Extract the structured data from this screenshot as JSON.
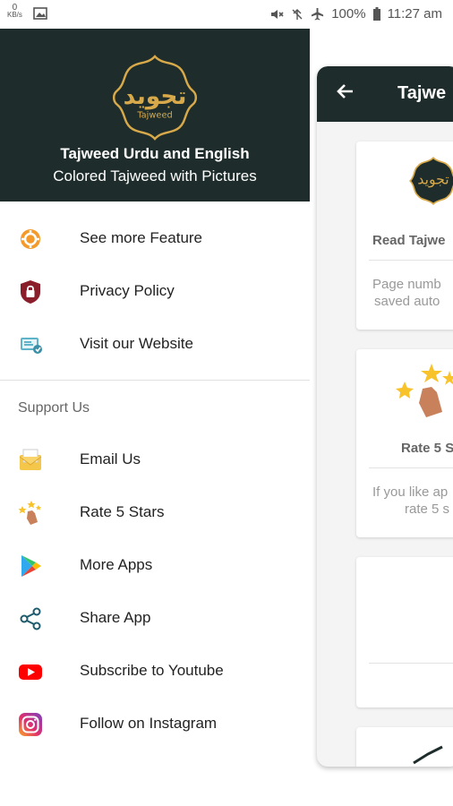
{
  "status_bar": {
    "net_speed_value": "0",
    "net_speed_unit": "KB/s",
    "battery": "100%",
    "time": "11:27 am"
  },
  "drawer": {
    "header": {
      "logo_arabic": "تجويد",
      "logo_latin": "Tajweed",
      "title": "Tajweed Urdu and English",
      "subtitle": "Colored Tajweed with Pictures"
    },
    "items": [
      {
        "label": "See more Feature",
        "icon": "gear-icon"
      },
      {
        "label": "Privacy Policy",
        "icon": "lock-icon"
      },
      {
        "label": "Visit our Website",
        "icon": "website-icon"
      }
    ],
    "support_section": {
      "label": "Support Us",
      "items": [
        {
          "label": "Email Us",
          "icon": "email-icon"
        },
        {
          "label": "Rate 5 Stars",
          "icon": "rate-stars-icon"
        },
        {
          "label": "More Apps",
          "icon": "play-store-icon"
        },
        {
          "label": "Share App",
          "icon": "share-icon"
        },
        {
          "label": "Subscribe to Youtube",
          "icon": "youtube-icon"
        },
        {
          "label": "Follow on Instagram",
          "icon": "instagram-icon"
        }
      ]
    }
  },
  "background_screen": {
    "toolbar_title": "Tajwe",
    "cards": [
      {
        "title": "Read Tajwe",
        "desc_line1": "Page numb",
        "desc_line2": "saved auto"
      },
      {
        "title": "Rate 5 S",
        "desc_line1": "If you like ap",
        "desc_line2": "rate 5 s"
      }
    ]
  },
  "colors": {
    "header_bg": "#1e2d2b",
    "logo_gold": "#d8a94a"
  }
}
